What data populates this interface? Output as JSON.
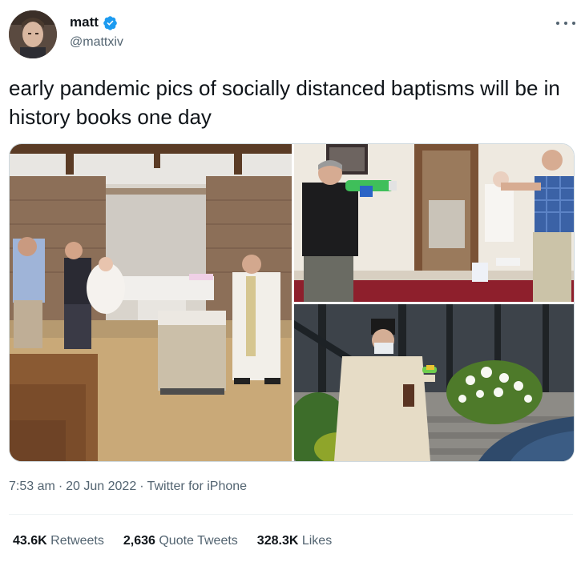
{
  "author": {
    "display_name": "matt",
    "handle": "@mattxiv",
    "verified": true,
    "verified_color": "#1d9bf0"
  },
  "tweet": {
    "text": "early pandemic pics of socially distanced baptisms will be in history books one day"
  },
  "media": {
    "count": 3,
    "photos": [
      "photo-1",
      "photo-2",
      "photo-3"
    ]
  },
  "meta": {
    "time": "7:53 am",
    "date": "20 Jun 2022",
    "separator": "·",
    "source": "Twitter for iPhone"
  },
  "stats": [
    {
      "value": "43.6K",
      "label": "Retweets"
    },
    {
      "value": "2,636",
      "label": "Quote Tweets"
    },
    {
      "value": "328.3K",
      "label": "Likes"
    }
  ],
  "colors": {
    "text": "#0f1419",
    "secondary": "#536471",
    "border": "#cfd9de"
  }
}
